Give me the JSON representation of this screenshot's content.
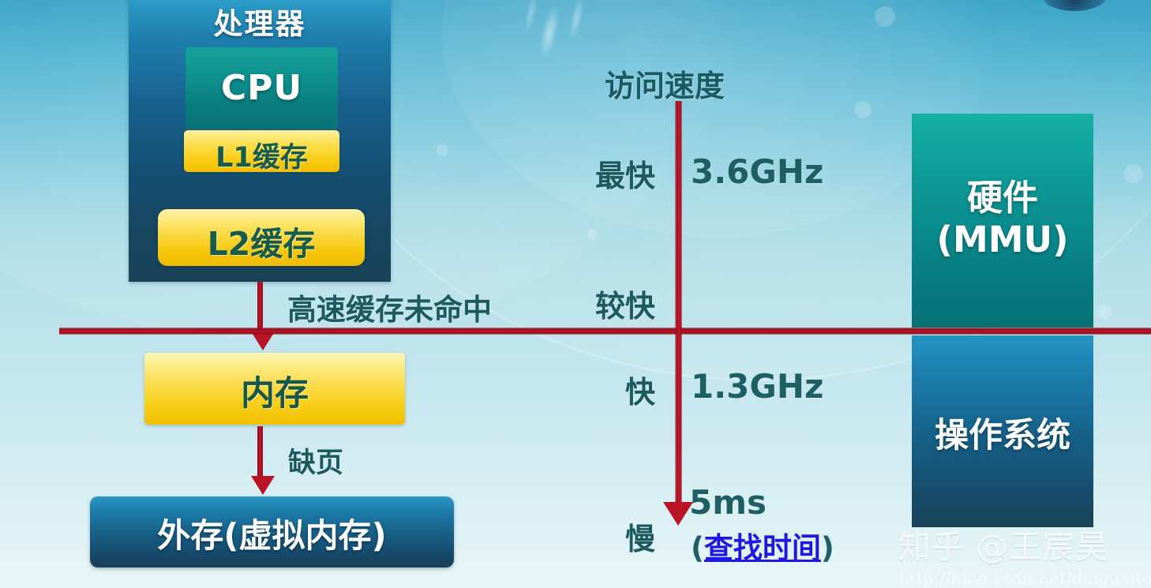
{
  "diagram": {
    "title_cut_top": "处理器",
    "processor": {
      "title": "处理器",
      "cpu_label": "CPU",
      "l1_label": "L1缓存",
      "l2_label": "L2缓存"
    },
    "memory_label": "内存",
    "storage_label": "外存(虚拟内存)",
    "flow_labels": {
      "cache_miss": "高速缓存未命中",
      "page_fault": "缺页"
    },
    "speed_axis": {
      "title": "访问速度",
      "levels": [
        {
          "word": "最快",
          "value": "3.6GHz",
          "value_sub": ""
        },
        {
          "word": "较快",
          "value": "",
          "value_sub": ""
        },
        {
          "word": "快",
          "value": "1.3GHz",
          "value_sub": ""
        },
        {
          "word": "慢",
          "value": "5ms",
          "value_sub_open": "(",
          "value_sub_hl": "查找时间",
          "value_sub_close": ")"
        }
      ]
    },
    "right_blocks": {
      "hardware_line1": "硬件",
      "hardware_line2": "(MMU)",
      "os_label": "操作系统"
    }
  },
  "watermark": {
    "handle": "知乎 @王宸昊",
    "url": "http://blog.csdn.net/daiguaito"
  },
  "colors": {
    "accent_red": "#c2122a",
    "teal_text": "#1c5a60",
    "yellow_box": "#f8cf1c",
    "blue_box": "#16608a",
    "mmu_teal": "#0a8a8c",
    "highlight_blue": "#2018e0"
  }
}
